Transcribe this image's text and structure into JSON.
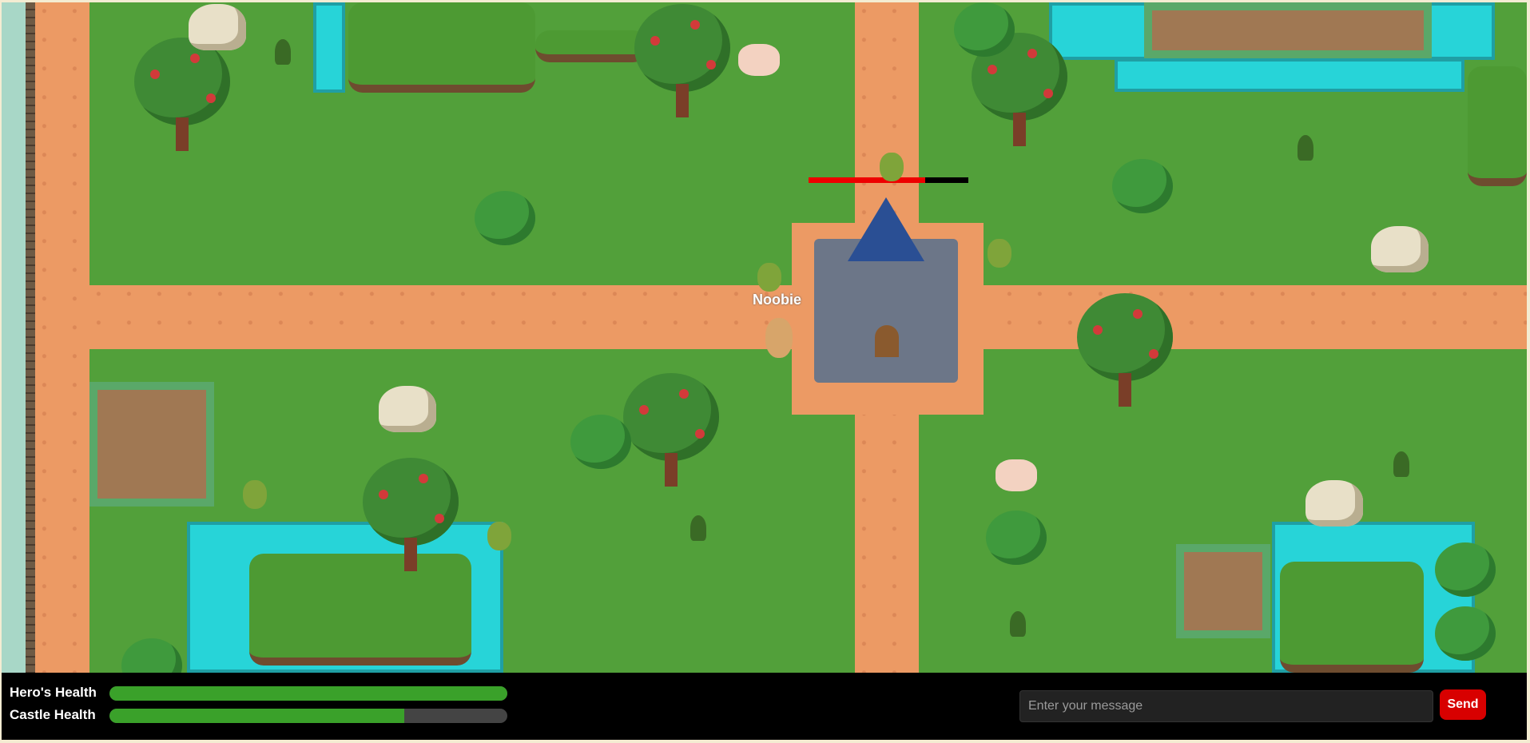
{
  "hud": {
    "hero_health_label": "Hero's Health",
    "castle_health_label": "Castle Health",
    "hero_health_fraction": 1.0,
    "castle_health_fraction": 0.74
  },
  "chat": {
    "placeholder": "Enter your message",
    "send_label": "Send"
  },
  "player": {
    "name": "Noobie"
  },
  "enemy_health_fraction": 0.73,
  "colors": {
    "grass": "#52a03a",
    "road": "#ec9a64",
    "water": "#27d4d8",
    "health_fill": "#3aa12a",
    "enemy_health": "#e00000",
    "send_button": "#d80000"
  }
}
